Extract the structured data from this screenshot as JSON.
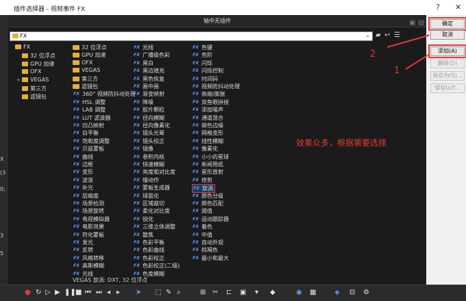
{
  "window": {
    "title": "插件选择器 - 视频事件 FX",
    "help": "?",
    "close": "✕"
  },
  "panel": {
    "title": "轴中无插件",
    "path": "FX"
  },
  "tree": [
    {
      "label": "FX",
      "level": 0,
      "expander": ""
    },
    {
      "label": "32 位浮点",
      "level": 1,
      "expander": ""
    },
    {
      "label": "GPU 加速",
      "level": 1,
      "expander": ""
    },
    {
      "label": "OFX",
      "level": 1,
      "expander": ""
    },
    {
      "label": "VEGAS",
      "level": 1,
      "expander": "+"
    },
    {
      "label": "第三方",
      "level": 1,
      "expander": ""
    },
    {
      "label": "滤镜包",
      "level": 1,
      "expander": ""
    }
  ],
  "col1": [
    {
      "label": "32 位浮点",
      "icon": "folder"
    },
    {
      "label": "GPU 加速",
      "icon": "folder"
    },
    {
      "label": "OFX",
      "icon": "folder"
    },
    {
      "label": "VEGAS",
      "icon": "folder"
    },
    {
      "label": "第三方",
      "icon": "folder"
    },
    {
      "label": "滤镜包",
      "icon": "folder"
    },
    {
      "label": "360° 视频防抖动处理",
      "icon": "fx"
    },
    {
      "label": "HSL 调整",
      "icon": "fx"
    },
    {
      "label": "LAB 调整",
      "icon": "fx"
    },
    {
      "label": "LUT 滤波器",
      "icon": "fx"
    },
    {
      "label": "凹凸映射",
      "icon": "fx"
    },
    {
      "label": "白平衡",
      "icon": "fx"
    },
    {
      "label": "饱和度调整",
      "icon": "fx"
    },
    {
      "label": "贝兹蒙板",
      "icon": "fx"
    },
    {
      "label": "曲线",
      "icon": "fx"
    },
    {
      "label": "边框",
      "icon": "fx"
    },
    {
      "label": "变形",
      "icon": "fx"
    },
    {
      "label": "波浪",
      "icon": "fx"
    },
    {
      "label": "补光",
      "icon": "fx"
    },
    {
      "label": "层缩度",
      "icon": "fx"
    },
    {
      "label": "场景检测",
      "icon": "fx"
    },
    {
      "label": "场景旋转",
      "icon": "fx"
    },
    {
      "label": "电视模拟器",
      "icon": "fx"
    },
    {
      "label": "电影效果",
      "icon": "fx"
    },
    {
      "label": "符化蒙板",
      "icon": "fx"
    },
    {
      "label": "发光",
      "icon": "fx"
    },
    {
      "label": "反转",
      "icon": "fx"
    },
    {
      "label": "风格转移",
      "icon": "fx"
    },
    {
      "label": "高斯模糊",
      "icon": "fx"
    },
    {
      "label": "光线",
      "icon": "fx"
    }
  ],
  "col2": [
    {
      "label": "光线",
      "icon": "fx"
    },
    {
      "label": "广播级色彩",
      "icon": "fx"
    },
    {
      "label": "黑白",
      "icon": "fx"
    },
    {
      "label": "黑边填充",
      "icon": "fx"
    },
    {
      "label": "黑色恢复",
      "icon": "fx"
    },
    {
      "label": "画中画",
      "icon": "fx"
    },
    {
      "label": "渐变映射",
      "icon": "fx"
    },
    {
      "label": "降噪",
      "icon": "fx"
    },
    {
      "label": "胶片颗粒",
      "icon": "fx"
    },
    {
      "label": "径向模糊",
      "icon": "fx"
    },
    {
      "label": "径向像素化",
      "icon": "fx"
    },
    {
      "label": "镜头光晕",
      "icon": "fx"
    },
    {
      "label": "镜头校正",
      "icon": "fx"
    },
    {
      "label": "镜像",
      "icon": "fx"
    },
    {
      "label": "卷积内核",
      "icon": "fx"
    },
    {
      "label": "快速模糊",
      "icon": "fx"
    },
    {
      "label": "亮度和对比度",
      "icon": "fx"
    },
    {
      "label": "慢动作",
      "icon": "fx"
    },
    {
      "label": "蒙板生成器",
      "icon": "fx"
    },
    {
      "label": "球面化",
      "icon": "fx"
    },
    {
      "label": "区域裁切",
      "icon": "fx"
    },
    {
      "label": "柔化对比度",
      "icon": "fx"
    },
    {
      "label": "锐化",
      "icon": "fx"
    },
    {
      "label": "三维立体调整",
      "icon": "fx"
    },
    {
      "label": "散焦",
      "icon": "fx"
    },
    {
      "label": "色彩平衡",
      "icon": "fx"
    },
    {
      "label": "色彩曲线",
      "icon": "fx"
    },
    {
      "label": "色彩校正",
      "icon": "fx"
    },
    {
      "label": "色彩校正(二级)",
      "icon": "fx"
    },
    {
      "label": "色度模糊",
      "icon": "fx"
    }
  ],
  "col3": [
    {
      "label": "色键",
      "icon": "fx"
    },
    {
      "label": "色阶",
      "icon": "fx"
    },
    {
      "label": "闪烁",
      "icon": "fx"
    },
    {
      "label": "闪烁控制",
      "icon": "fx"
    },
    {
      "label": "时间码",
      "icon": "fx"
    },
    {
      "label": "视频防抖动处理",
      "icon": "fx"
    },
    {
      "label": "收缩/膨胀",
      "icon": "fx"
    },
    {
      "label": "双鱼眼拼接",
      "icon": "fx"
    },
    {
      "label": "添加噪声",
      "icon": "fx"
    },
    {
      "label": "通道混合",
      "icon": "fx"
    },
    {
      "label": "褪色边缘",
      "icon": "fx"
    },
    {
      "label": "网格变形",
      "icon": "fx"
    },
    {
      "label": "线性模糊",
      "icon": "fx"
    },
    {
      "label": "像素化",
      "icon": "fx"
    },
    {
      "label": "小小的星球",
      "icon": "fx"
    },
    {
      "label": "新闻用纸",
      "icon": "fx"
    },
    {
      "label": "星形放射",
      "icon": "fx"
    },
    {
      "label": "修剪",
      "icon": "fx"
    },
    {
      "label": "旋涡",
      "icon": "fx",
      "selected": true
    },
    {
      "label": "颜色分级",
      "icon": "fx"
    },
    {
      "label": "颜色匹配",
      "icon": "fx"
    },
    {
      "label": "阈值",
      "icon": "fx"
    },
    {
      "label": "运动跟踪器",
      "icon": "fx"
    },
    {
      "label": "着色",
      "icon": "fx"
    },
    {
      "label": "中值",
      "icon": "fx"
    },
    {
      "label": "自动外观",
      "icon": "fx"
    },
    {
      "label": "棕褐色",
      "icon": "fx"
    },
    {
      "label": "最小和最大",
      "icon": "fx"
    }
  ],
  "status": "VEGAS 旋涡: DXT, 32 位浮点",
  "buttons": [
    {
      "label": "确定",
      "enabled": true,
      "highlight": true
    },
    {
      "label": "取消",
      "enabled": true,
      "highlight": false
    },
    {
      "label": "添加(A)",
      "enabled": true,
      "highlight": true
    },
    {
      "label": "删除(D)",
      "enabled": false,
      "highlight": false
    },
    {
      "label": "另存为(S)...",
      "enabled": false,
      "highlight": false
    },
    {
      "label": "保存LUT...",
      "enabled": false,
      "highlight": false
    }
  ],
  "annotations": {
    "note": "效果众多，根据需要选择",
    "num1": "1",
    "num2": "2"
  },
  "left_fragments": [
    "X",
    "(3",
    "0;",
    "3",
    "5"
  ],
  "colors": {
    "accent": "#e53935",
    "fx_icon": "#5aa0ff",
    "folder": "#e2b13c"
  }
}
